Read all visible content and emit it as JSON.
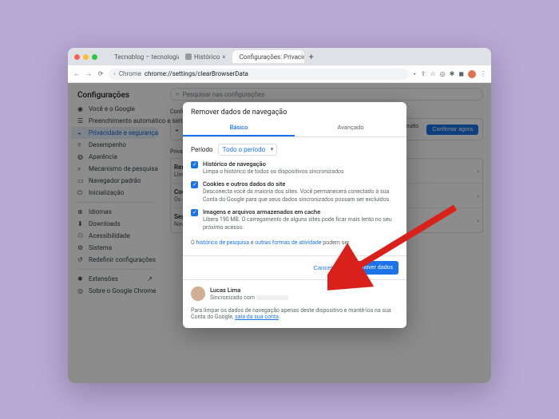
{
  "tabs": [
    {
      "label": "Tecnoblog – tecnologia que i",
      "favicon": "#0aa"
    },
    {
      "label": "Histórico",
      "favicon": "#888"
    },
    {
      "label": "Configurações: Privacidade e",
      "favicon": "#1a73e8",
      "active": true
    }
  ],
  "url": {
    "host": "Chrome",
    "path": "chrome://settings/clearBrowserData"
  },
  "page_title": "Configurações",
  "search_placeholder": "Pesquisar nas configurações",
  "sidebar": {
    "items": [
      {
        "icon": "person",
        "label": "Você e o Google"
      },
      {
        "icon": "autofill",
        "label": "Preenchimento automático e senhas"
      },
      {
        "icon": "shield",
        "label": "Privacidade e segurança",
        "active": true
      },
      {
        "icon": "speed",
        "label": "Desempenho"
      },
      {
        "icon": "paint",
        "label": "Aparência"
      },
      {
        "icon": "search",
        "label": "Mecanismo de pesquisa"
      },
      {
        "icon": "browser",
        "label": "Navegador padrão"
      },
      {
        "icon": "power",
        "label": "Inicialização"
      }
    ],
    "secondary": [
      {
        "icon": "lang",
        "label": "Idiomas"
      },
      {
        "icon": "download",
        "label": "Downloads"
      },
      {
        "icon": "a11y",
        "label": "Acessibilidade"
      },
      {
        "icon": "system",
        "label": "Sistema"
      },
      {
        "icon": "reset",
        "label": "Redefinir configurações"
      }
    ],
    "footer": [
      {
        "icon": "ext",
        "label": "Extensões"
      },
      {
        "icon": "about",
        "label": "Sobre o Google Chrome"
      }
    ]
  },
  "main": {
    "section1_title": "Confirmação de segurança",
    "check_text": "O Chrome pode ajudar na sua proteção contra violações de dados, extensões inválidas e muito mais",
    "check_btn": "Confirmar agora",
    "section2_title": "Privacidade e segurança",
    "rows": [
      {
        "title": "Remover dados de navegação",
        "sub": "Limpar histórico, cookies, cache e muito mais"
      },
      {
        "title": "Cookies e outros dados do site",
        "sub": "Os cookies de terceiros estão bloqueados no modo de navegação anônima"
      },
      {
        "title": "Segurança",
        "sub": "Navegação segura (proteção contra sites perigosos) e outras configurações de segurança"
      }
    ]
  },
  "modal": {
    "title": "Remover dados de navegação",
    "tab_basic": "Básico",
    "tab_advanced": "Avançado",
    "period_label": "Período",
    "period_value": "Todo o período",
    "options": [
      {
        "title": "Histórico de navegação",
        "desc": "Limpa o histórico de todos os dispositivos sincronizados"
      },
      {
        "title": "Cookies e outros dados do site",
        "desc": "Desconecta você da maioria dos sites. Você permanecerá conectado à sua Conta do Google para que seus dados sincronizados possam ser excluídos."
      },
      {
        "title": "Imagens e arquivos armazenados em cache",
        "desc": "Libera 190 MB. O carregamento de alguns sites pode ficar mais lento no seu próximo acesso."
      }
    ],
    "note_pre": "O ",
    "note_link1": "histórico de pesquisa",
    "note_mid": " e ",
    "note_link2": "outras formas de atividade",
    "note_post": " podem ser",
    "cancel": "Cancelar",
    "confirm": "Remover dados",
    "user_name": "Lucas Lima",
    "user_sync": "Sincronizado com",
    "foot_text": "Para limpar os dados de navegação apenas deste dispositivo e mantê-los na sua Conta do Google, ",
    "foot_link": "saia da sua conta"
  }
}
